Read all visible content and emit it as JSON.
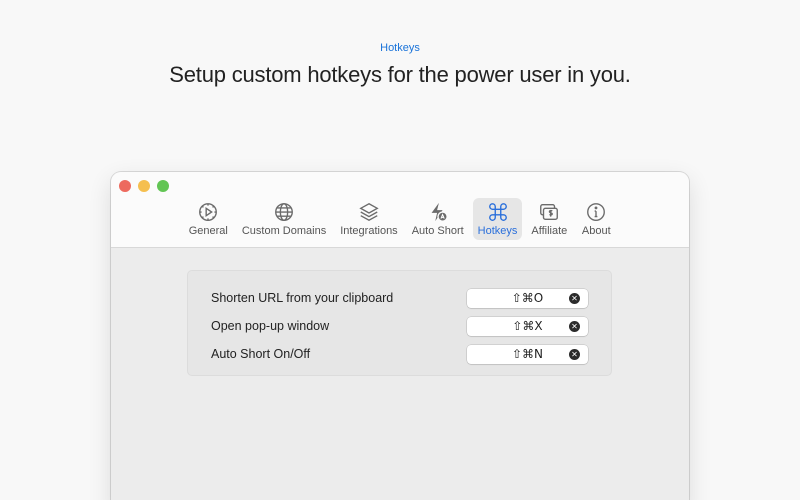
{
  "hero": {
    "tag": "Hotkeys",
    "title": "Setup custom hotkeys for the  power user in you."
  },
  "window": {
    "tabs": [
      {
        "label": "General",
        "icon": "gauge-icon"
      },
      {
        "label": "Custom Domains",
        "icon": "globe-icon"
      },
      {
        "label": "Integrations",
        "icon": "layers-icon"
      },
      {
        "label": "Auto Short",
        "icon": "bolt-a-icon"
      },
      {
        "label": "Hotkeys",
        "icon": "command-icon",
        "active": true
      },
      {
        "label": "Affiliate",
        "icon": "dollar-bill-icon"
      },
      {
        "label": "About",
        "icon": "info-icon"
      }
    ],
    "hotkeys": [
      {
        "label": "Shorten URL from your clipboard",
        "keys": "⇧⌘O"
      },
      {
        "label": "Open pop-up window",
        "keys": "⇧⌘X"
      },
      {
        "label": "Auto Short On/Off",
        "keys": "⇧⌘N"
      }
    ],
    "clear_glyph": "✕"
  },
  "colors": {
    "accent": "#2a6fdb",
    "hero_tag": "#1a73d9",
    "close": "#ed6a5e",
    "minimize": "#f5bf4f",
    "maximize": "#62c554"
  }
}
